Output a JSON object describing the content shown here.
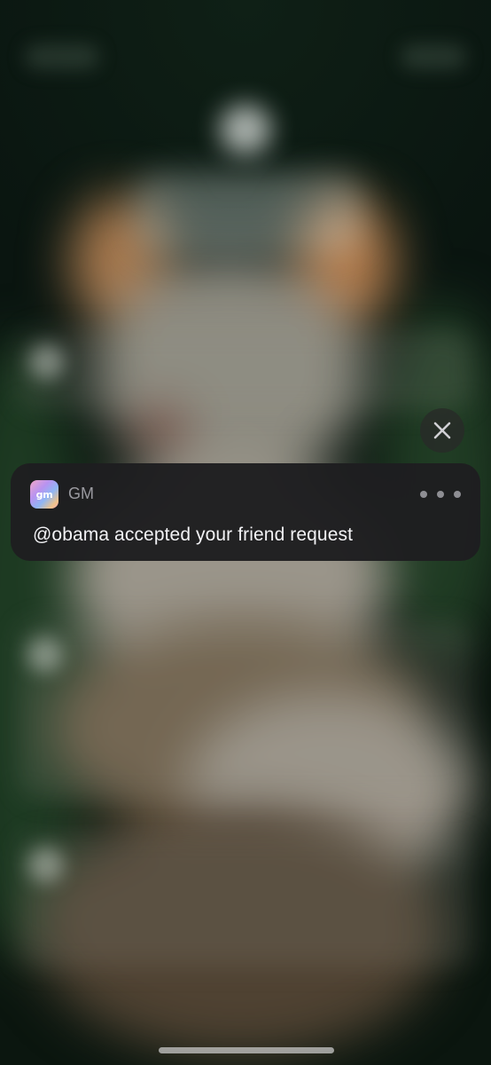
{
  "notification": {
    "app_name": "GM",
    "app_icon_text": "gm",
    "message": "@obama accepted your friend request",
    "more_icon": "ellipsis-icon",
    "background_color": "#1e1e20"
  },
  "close_button": {
    "icon": "close-icon"
  },
  "colors": {
    "accent_green": "#0f2016",
    "text_primary": "#f2f2f5",
    "text_secondary": "#9a9aa0"
  }
}
